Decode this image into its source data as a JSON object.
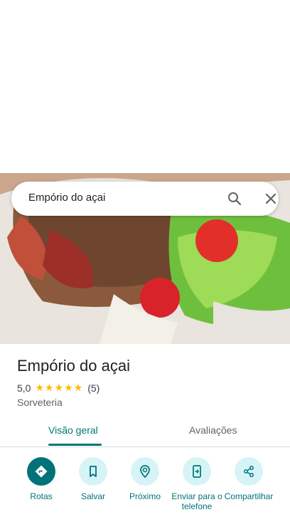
{
  "search": {
    "query": "Empório do açai"
  },
  "place": {
    "name": "Empório do açai",
    "rating": "5,0",
    "stars": "★★★★★",
    "review_count": "(5)",
    "category": "Sorveteria"
  },
  "tabs": [
    {
      "label": "Visão geral",
      "selected": true
    },
    {
      "label": "Avaliações",
      "selected": false
    }
  ],
  "actions": [
    {
      "label": "Rotas",
      "icon": "directions-icon"
    },
    {
      "label": "Salvar",
      "icon": "bookmark-icon"
    },
    {
      "label": "Próximo",
      "icon": "nearby-icon"
    },
    {
      "label": "Enviar para o telefone",
      "icon": "send-to-phone-icon"
    },
    {
      "label": "Compartilhar",
      "icon": "share-icon"
    }
  ],
  "colors": {
    "accent": "#00796b",
    "action_bg": "#d6f4f6",
    "star": "#fbbc04"
  }
}
